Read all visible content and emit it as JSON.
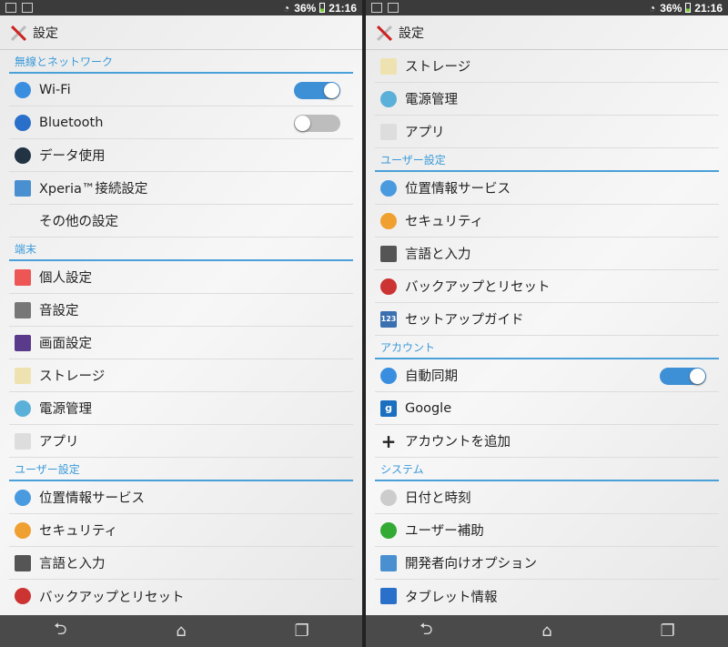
{
  "status": {
    "battery": "36%",
    "time": "21:16"
  },
  "title": "設定",
  "nav": {
    "back": "⮌",
    "home": "⌂",
    "recent": "❐"
  },
  "panels": [
    {
      "id": "left",
      "groups": [
        {
          "header": "無線とネットワーク",
          "items": [
            {
              "label": "Wi-Fi",
              "icon": "wifi-icon",
              "color": "#3a8ee0",
              "toggle": "on"
            },
            {
              "label": "Bluetooth",
              "icon": "bluetooth-icon",
              "color": "#2a6fc9",
              "toggle": "off"
            },
            {
              "label": "データ使用",
              "icon": "data-usage-icon",
              "color": "#234"
            },
            {
              "label": "Xperia™接続設定",
              "icon": "xperia-connect-icon",
              "color": "#4a8fd0",
              "sq": true
            },
            {
              "label": "その他の設定",
              "icon": "",
              "color": ""
            }
          ]
        },
        {
          "header": "端末",
          "items": [
            {
              "label": "個人設定",
              "icon": "personalize-icon",
              "color": "#e55",
              "sq": true
            },
            {
              "label": "音設定",
              "icon": "sound-icon",
              "color": "#777",
              "sq": true
            },
            {
              "label": "画面設定",
              "icon": "display-icon",
              "color": "#5a3a8a",
              "sq": true
            },
            {
              "label": "ストレージ",
              "icon": "storage-icon",
              "color": "#eee3b0",
              "sq": true
            },
            {
              "label": "電源管理",
              "icon": "power-icon",
              "color": "#5ab0d8"
            },
            {
              "label": "アプリ",
              "icon": "apps-icon",
              "color": "#ddd",
              "sq": true
            }
          ]
        },
        {
          "header": "ユーザー設定",
          "items": [
            {
              "label": "位置情報サービス",
              "icon": "location-icon",
              "color": "#4a9ae0"
            },
            {
              "label": "セキュリティ",
              "icon": "security-icon",
              "color": "#f0a030"
            },
            {
              "label": "言語と入力",
              "icon": "keyboard-icon",
              "color": "#555",
              "sq": true
            },
            {
              "label": "バックアップとリセット",
              "icon": "backup-icon",
              "color": "#c33"
            }
          ]
        }
      ]
    },
    {
      "id": "right",
      "groups": [
        {
          "header": "",
          "items": [
            {
              "label": "ストレージ",
              "icon": "storage-icon",
              "color": "#eee3b0",
              "sq": true
            },
            {
              "label": "電源管理",
              "icon": "power-icon",
              "color": "#5ab0d8"
            },
            {
              "label": "アプリ",
              "icon": "apps-icon",
              "color": "#ddd",
              "sq": true
            }
          ]
        },
        {
          "header": "ユーザー設定",
          "items": [
            {
              "label": "位置情報サービス",
              "icon": "location-icon",
              "color": "#4a9ae0"
            },
            {
              "label": "セキュリティ",
              "icon": "security-icon",
              "color": "#f0a030"
            },
            {
              "label": "言語と入力",
              "icon": "keyboard-icon",
              "color": "#555",
              "sq": true
            },
            {
              "label": "バックアップとリセット",
              "icon": "backup-icon",
              "color": "#c33"
            },
            {
              "label": "セットアップガイド",
              "icon": "setup-guide-icon",
              "color": "#3a6fb0",
              "sq": true,
              "glyph": "123"
            }
          ]
        },
        {
          "header": "アカウント",
          "items": [
            {
              "label": "自動同期",
              "icon": "sync-icon",
              "color": "#3a8ee0",
              "toggle": "on"
            },
            {
              "label": "Google",
              "icon": "google-icon",
              "color": "#1a6fc0",
              "sq": true,
              "glyph": "g"
            },
            {
              "label": "アカウントを追加",
              "icon": "plus-icon",
              "color": "transparent",
              "glyph": "+"
            }
          ]
        },
        {
          "header": "システム",
          "items": [
            {
              "label": "日付と時刻",
              "icon": "clock-icon",
              "color": "#ccc"
            },
            {
              "label": "ユーザー補助",
              "icon": "accessibility-icon",
              "color": "#3a3"
            },
            {
              "label": "開発者向けオプション",
              "icon": "developer-icon",
              "color": "#4a8fd0",
              "sq": true
            },
            {
              "label": "タブレット情報",
              "icon": "tablet-icon",
              "color": "#2a6fc9",
              "sq": true
            }
          ]
        }
      ]
    }
  ]
}
